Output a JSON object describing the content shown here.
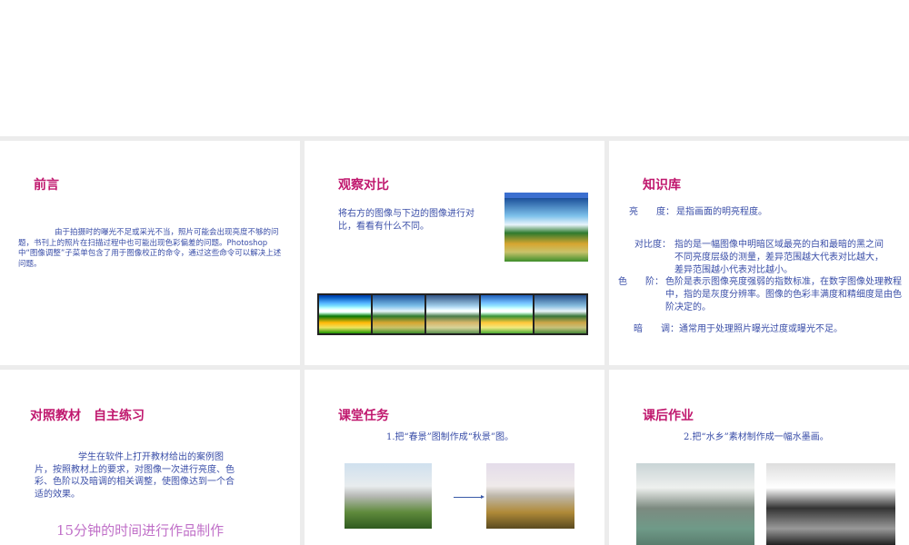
{
  "slides": [
    {
      "title": "前言",
      "body": "由于拍摄时的曝光不足或采光不当，照片可能会出现亮度不够的问题，书刊上的照片在扫描过程中也可能出现色彩偏差的问题。Photoshop 中“图像调整”子菜单包含了用于图像校正的命令，通过这些命令可以解决上述问题。"
    },
    {
      "title": "观察对比",
      "body": "将右方的图像与下边的图像进行对比，看看有什么不同。"
    },
    {
      "title": "知识库",
      "items": [
        {
          "term": "亮　　度：",
          "desc": "是指画面的明亮程度。"
        },
        {
          "term": "对比度：",
          "desc": "指的是一幅图像中明暗区域最亮的白和最暗的黑之间不同亮度层级的测量，差异范围越大代表对比越大，差异范围越小代表对比越小。"
        },
        {
          "term": "色　　阶：",
          "desc": "色阶是表示图像亮度强弱的指数标准，在数字图像处理教程中，指的是灰度分辨率。图像的色彩丰满度和精细度是由色阶决定的。"
        },
        {
          "term": "暗　　调：",
          "desc": "通常用于处理照片曝光过度或曝光不足。"
        }
      ]
    },
    {
      "title": "对照教材　自主练习",
      "body": "学生在软件上打开教材给出的案例图片，按照教材上的要求，对图像一次进行亮度、色彩、色阶以及暗调的相关调整，使图像达到一个合适的效果。",
      "note": "15分钟的时间进行作品制作"
    },
    {
      "title": "课堂任务",
      "body": "1.把“春景”图制作成“秋景”图。"
    },
    {
      "title": "课后作业",
      "body": "2.把“水乡”素材制作成一幅水墨画。"
    }
  ]
}
